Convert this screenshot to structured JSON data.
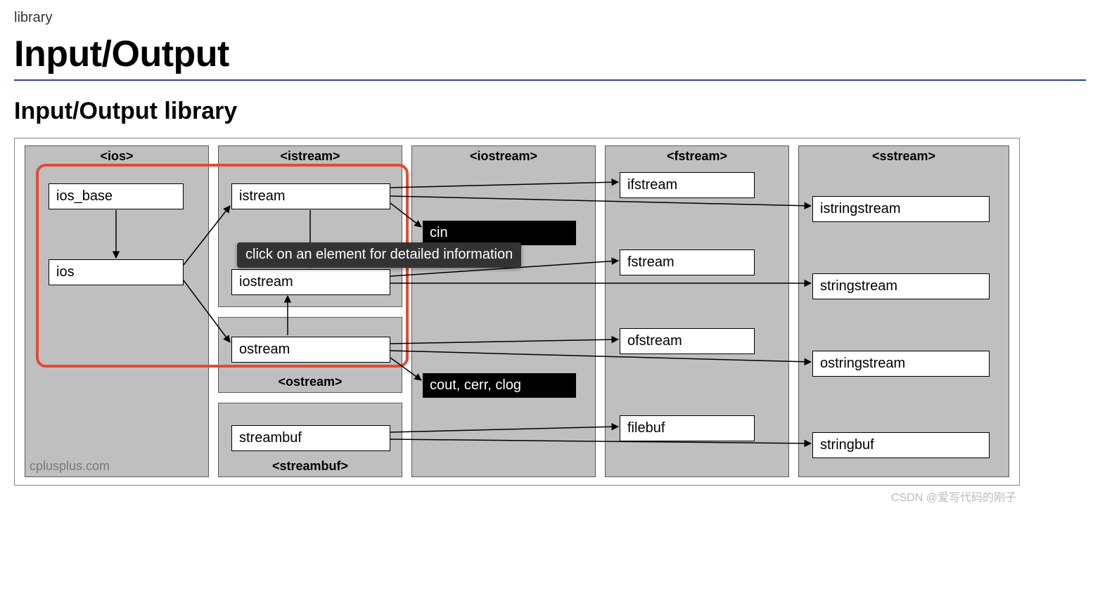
{
  "breadcrumb": "library",
  "page_title": "Input/Output",
  "section_title": "Input/Output library",
  "tooltip": "click on an element for detailed information",
  "site_label": "cplusplus.com",
  "watermark": "CSDN @爱写代码的刚子",
  "panels": {
    "ios": {
      "header": "<ios>"
    },
    "istream": {
      "header": "<istream>"
    },
    "ostream": {
      "footer": "<ostream>"
    },
    "streambuf": {
      "footer": "<streambuf>"
    },
    "iostream": {
      "header": "<iostream>"
    },
    "fstream": {
      "header": "<fstream>"
    },
    "sstream": {
      "header": "<sstream>"
    }
  },
  "classes": {
    "ios_base": "ios_base",
    "ios": "ios",
    "istream": "istream",
    "iostream": "iostream",
    "ostream": "ostream",
    "streambuf": "streambuf",
    "ifstream": "ifstream",
    "fstream": "fstream",
    "ofstream": "ofstream",
    "filebuf": "filebuf",
    "istringstream": "istringstream",
    "stringstream": "stringstream",
    "ostringstream": "ostringstream",
    "stringbuf": "stringbuf"
  },
  "objects": {
    "cin": "cin",
    "cout_group": "cout, cerr, clog"
  }
}
